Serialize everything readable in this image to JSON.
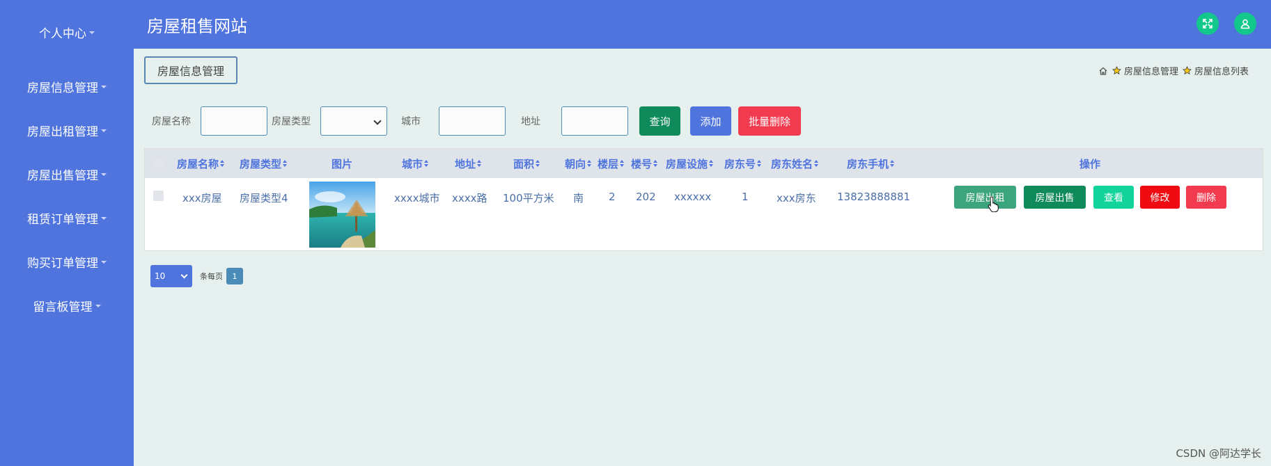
{
  "app": {
    "title": "房屋租售网站"
  },
  "colors": {
    "primary": "#4f74de",
    "accent_green": "#12c88a",
    "danger": "#f23b4f"
  },
  "sidebar": {
    "items": [
      {
        "label": "个人中心"
      },
      {
        "label": "房屋信息管理"
      },
      {
        "label": "房屋出租管理"
      },
      {
        "label": "房屋出售管理"
      },
      {
        "label": "租赁订单管理"
      },
      {
        "label": "购买订单管理"
      },
      {
        "label": "留言板管理"
      }
    ]
  },
  "header": {
    "icons": [
      "expand-icon",
      "user-icon"
    ]
  },
  "tab": {
    "label": "房屋信息管理"
  },
  "breadcrumb": {
    "items": [
      "房屋信息管理",
      "房屋信息列表"
    ]
  },
  "search": {
    "name_label": "房屋名称",
    "type_label": "房屋类型",
    "city_label": "城市",
    "address_label": "地址",
    "query_label": "查询",
    "add_label": "添加",
    "batch_delete_label": "批量删除"
  },
  "table": {
    "headers": [
      "房屋名称",
      "房屋类型",
      "图片",
      "城市",
      "地址",
      "面积",
      "朝向",
      "楼层",
      "楼号",
      "房屋设施",
      "房东号",
      "房东姓名",
      "房东手机",
      "操作"
    ],
    "rows": [
      {
        "name": "xxx房屋",
        "type": "房屋类型4",
        "city": "xxxx城市",
        "address": "xxxx路",
        "area": "100平方米",
        "orientation": "南",
        "floor": "2",
        "building": "202",
        "facilities": "xxxxxx",
        "landlord_id": "1",
        "landlord_name": "xxx房东",
        "landlord_phone": "13823888881"
      }
    ],
    "actions": {
      "rent": "房屋出租",
      "sell": "房屋出售",
      "view": "查看",
      "edit": "修改",
      "delete": "删除"
    }
  },
  "pagination": {
    "page_size": "10",
    "per_page_label": "条每页",
    "current_page": "1"
  },
  "watermark": "CSDN @阿达学长"
}
